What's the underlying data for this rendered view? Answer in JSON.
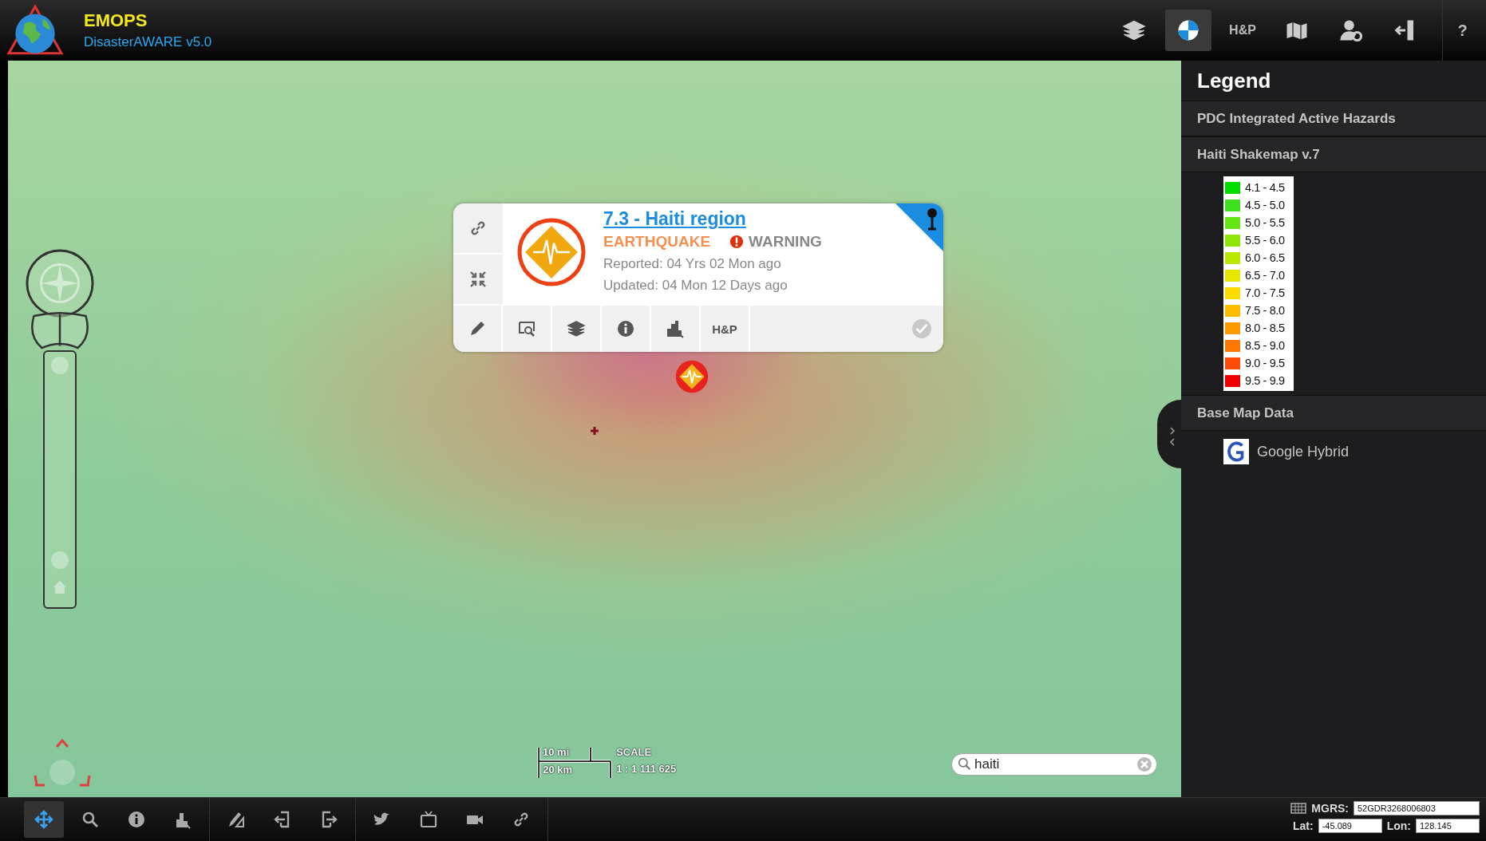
{
  "app": {
    "title": "EMOPS",
    "subtitle": "DisasterAWARE v5.0"
  },
  "header_tools": [
    {
      "kind": "layers",
      "selected": false
    },
    {
      "kind": "globe",
      "selected": true
    },
    {
      "kind": "text",
      "label": "H&P",
      "selected": false
    },
    {
      "kind": "map",
      "selected": false
    },
    {
      "kind": "user-settings",
      "selected": false
    },
    {
      "kind": "logout",
      "selected": false
    },
    {
      "kind": "text",
      "label": "?",
      "selected": false
    }
  ],
  "popup": {
    "title": "7.3 - Haiti region",
    "hazard_type": "EARTHQUAKE",
    "severity": "WARNING",
    "reported": "Reported: 04 Yrs 02 Mon ago",
    "updated": "Updated: 04 Mon 12 Days ago",
    "pinned": true,
    "side_tools": [
      {
        "kind": "link"
      },
      {
        "kind": "collapse"
      }
    ],
    "tools": [
      {
        "kind": "pencil"
      },
      {
        "kind": "zoom-to"
      },
      {
        "kind": "layers"
      },
      {
        "kind": "info"
      },
      {
        "kind": "chart"
      },
      {
        "kind": "text",
        "label": "H&P"
      }
    ]
  },
  "scale": {
    "miles": "10 mi",
    "km": "20 km",
    "title": "SCALE",
    "ratio": "1 : 1 111 625"
  },
  "search": {
    "value": "haiti"
  },
  "legend": {
    "title": "Legend",
    "sections": [
      {
        "title": "PDC Integrated Active Hazards"
      },
      {
        "title": "Haiti Shakemap v.7",
        "entries": [
          {
            "label": "4.1 - 4.5",
            "color": "#00dc00"
          },
          {
            "label": "4.5 - 5.0",
            "color": "#3fe01f"
          },
          {
            "label": "5.0 - 5.5",
            "color": "#66e614"
          },
          {
            "label": "5.5 - 6.0",
            "color": "#8ee60a"
          },
          {
            "label": "6.0 - 6.5",
            "color": "#bbe600"
          },
          {
            "label": "6.5 - 7.0",
            "color": "#e6e600"
          },
          {
            "label": "7.0 - 7.5",
            "color": "#ffdc00"
          },
          {
            "label": "7.5 - 8.0",
            "color": "#ffbb00"
          },
          {
            "label": "8.0 - 8.5",
            "color": "#ff9900"
          },
          {
            "label": "8.5 - 9.0",
            "color": "#ff7700"
          },
          {
            "label": "9.0 - 9.5",
            "color": "#ff4a0a"
          },
          {
            "label": "9.5 - 9.9",
            "color": "#ee0000"
          }
        ]
      },
      {
        "title": "Base Map Data",
        "layers": [
          {
            "name": "Google Hybrid"
          }
        ]
      }
    ]
  },
  "bottom_tools": [
    [
      {
        "kind": "move",
        "selected": true
      },
      {
        "kind": "search",
        "selected": false
      },
      {
        "kind": "info",
        "selected": false
      },
      {
        "kind": "chart",
        "selected": false
      }
    ],
    [
      {
        "kind": "draw",
        "selected": false
      },
      {
        "kind": "import",
        "selected": false
      },
      {
        "kind": "export",
        "selected": false
      }
    ],
    [
      {
        "kind": "bird",
        "selected": false
      },
      {
        "kind": "tv",
        "selected": false
      },
      {
        "kind": "video",
        "selected": false
      },
      {
        "kind": "link",
        "selected": false
      }
    ]
  ],
  "coordinates": {
    "mgrs_label": "MGRS:",
    "mgrs": "52GDR3268006803",
    "lat_label": "Lat:",
    "lat": "-45.089",
    "lon_label": "Lon:",
    "lon": "128.145"
  }
}
